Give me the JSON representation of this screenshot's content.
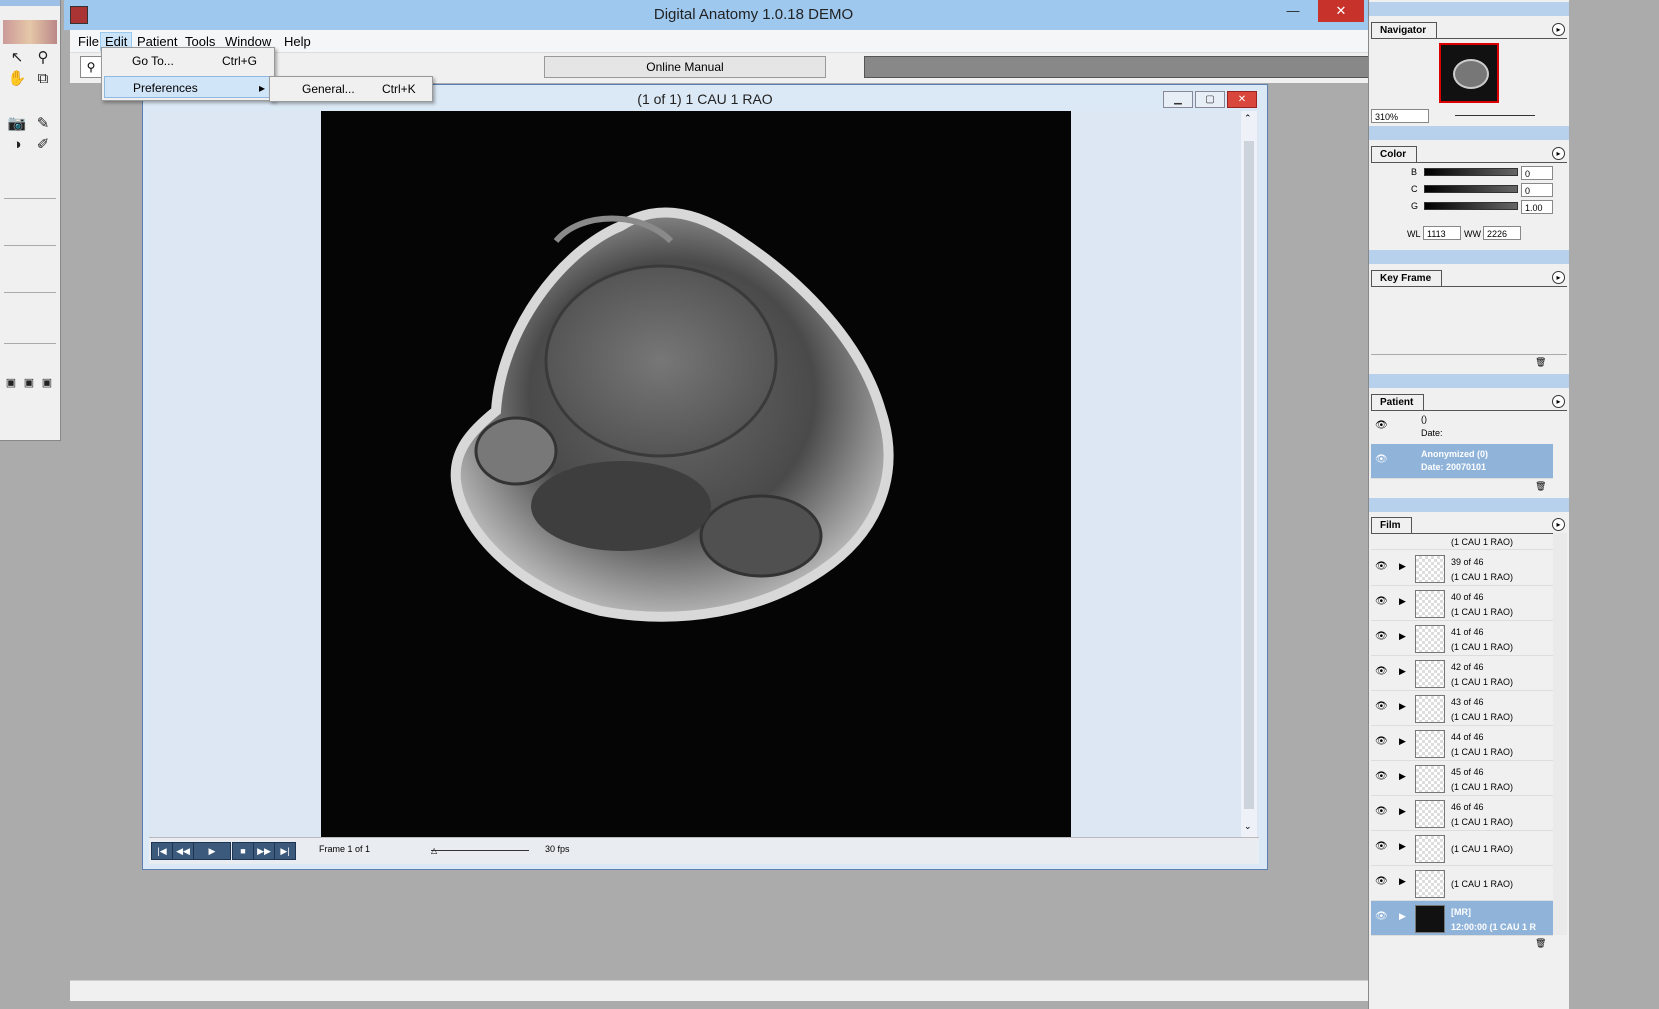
{
  "app": {
    "title": "Digital Anatomy 1.0.18 DEMO"
  },
  "window_controls": {
    "minimize": "—",
    "maximize": "☐",
    "close": "✕"
  },
  "menubar": {
    "items": [
      "File",
      "Edit",
      "Patient",
      "Tools",
      "Window",
      "Help"
    ],
    "active": "Edit"
  },
  "edit_menu": {
    "items": [
      {
        "label": "Go To...",
        "shortcut": "Ctrl+G"
      },
      {
        "label": "Preferences",
        "submenu_arrow": "▸"
      }
    ],
    "preferences_submenu": [
      {
        "label": "General...",
        "shortcut": "Ctrl+K"
      }
    ]
  },
  "toolbar": {
    "online_manual": "Online Manual"
  },
  "image_window": {
    "title": "(1 of 1) 1 CAU 1 RAO",
    "frame_label": "Frame 1 of 1",
    "fps_label": "30 fps"
  },
  "navigator": {
    "tab": "Navigator",
    "zoom": "310%"
  },
  "color_panel": {
    "tab": "Color",
    "b_label": "B",
    "b_value": "0",
    "c_label": "C",
    "c_value": "0",
    "g_label": "G",
    "g_value": "1.00",
    "wl_label": "WL",
    "wl_value": "1113",
    "ww_label": "WW",
    "ww_value": "2226"
  },
  "keyframe_panel": {
    "tab": "Key Frame"
  },
  "patient_panel": {
    "tab": "Patient",
    "items": [
      {
        "line1": "()",
        "line2": "Date:"
      },
      {
        "line1": "Anonymized (0)",
        "line2": "Date: 20070101"
      }
    ]
  },
  "film_panel": {
    "tab": "Film",
    "partial_top": "(1 CAU 1 RAO)",
    "items": [
      {
        "line1": "39 of 46",
        "line2": "(1 CAU 1 RAO)"
      },
      {
        "line1": "40 of 46",
        "line2": "(1 CAU 1 RAO)"
      },
      {
        "line1": "41 of 46",
        "line2": "(1 CAU 1 RAO)"
      },
      {
        "line1": "42 of 46",
        "line2": "(1 CAU 1 RAO)"
      },
      {
        "line1": "43 of 46",
        "line2": "(1 CAU 1 RAO)"
      },
      {
        "line1": "44 of 46",
        "line2": "(1 CAU 1 RAO)"
      },
      {
        "line1": "45 of 46",
        "line2": "(1 CAU 1 RAO)"
      },
      {
        "line1": "46 of 46",
        "line2": "(1 CAU 1 RAO)"
      },
      {
        "line1": "",
        "line2": "(1 CAU 1 RAO)"
      },
      {
        "line1": "",
        "line2": "(1 CAU 1 RAO)"
      }
    ],
    "selected": {
      "line1": "[MR]",
      "line2": "12:00:00 (1 CAU 1 R"
    }
  },
  "playback": {
    "buttons": [
      "|◀",
      "◀◀",
      "▶",
      "■",
      "▶▶",
      "▶|"
    ]
  },
  "colors": {
    "titlebar": "#9ec8ee",
    "close": "#c7322a",
    "selection": "#8fb3d9"
  }
}
